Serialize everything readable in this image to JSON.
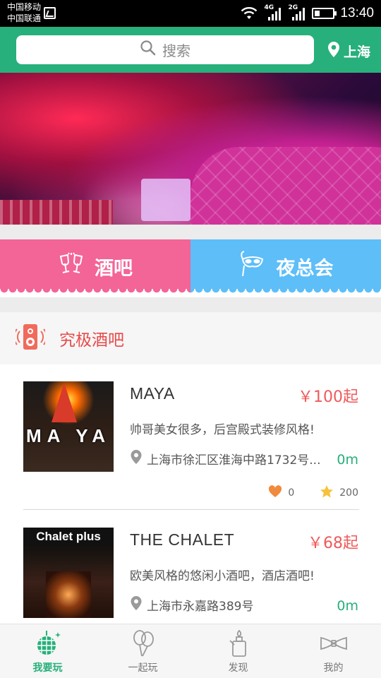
{
  "status_bar": {
    "carrier_1": "中国移动",
    "carrier_2": "中国联通",
    "net_1": "4G",
    "net_2": "2G",
    "time": "13:40"
  },
  "header": {
    "search_placeholder": "搜索",
    "city": "上海"
  },
  "banner": {
    "slide_count": 5,
    "active_slide": 2
  },
  "categories": [
    {
      "label": "酒吧",
      "icon": "cheers-glasses-icon",
      "color": "#f36497"
    },
    {
      "label": "夜总会",
      "icon": "masquerade-mask-icon",
      "color": "#5dbef8"
    }
  ],
  "section": {
    "title": "究极酒吧",
    "icon": "speaker-icon"
  },
  "venues": [
    {
      "name": "MAYA",
      "price": "￥100起",
      "description": "帅哥美女很多，后宫殿式装修风格!",
      "address": "上海市徐汇区淮海中路1732号...",
      "distance": "0m",
      "likes": "0",
      "rating": "200",
      "thumb_text": "MA YA"
    },
    {
      "name": "THE CHALET",
      "price": "￥68起",
      "description": "欧美风格的悠闲小酒吧，酒店酒吧!",
      "address": "上海市永嘉路389号",
      "distance": "0m",
      "thumb_text": "Chalet plus"
    }
  ],
  "tabs": [
    {
      "label": "我要玩",
      "icon": "disco-ball-icon",
      "active": true
    },
    {
      "label": "一起玩",
      "icon": "balloons-icon",
      "active": false
    },
    {
      "label": "发现",
      "icon": "lighter-icon",
      "active": false
    },
    {
      "label": "我的",
      "icon": "bow-tie-icon",
      "active": false
    }
  ],
  "colors": {
    "brand_green": "#27b07b",
    "price_red": "#ef5a5a",
    "section_red": "#e84a4a",
    "bar_pink": "#f36497",
    "club_blue": "#5dbef8"
  }
}
